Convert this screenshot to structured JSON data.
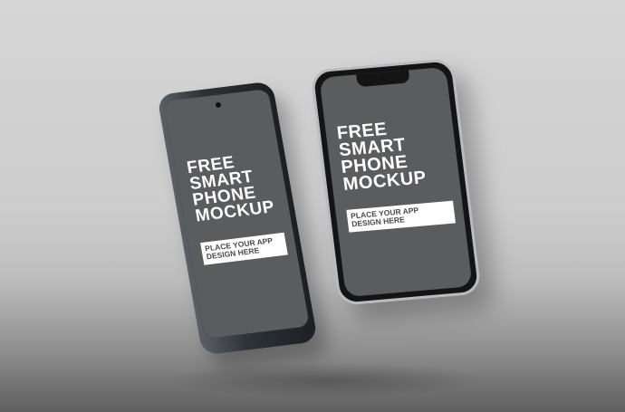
{
  "mockup": {
    "left_phone": {
      "headline": "FREE\nSMART\nPHONE\nMOCKUP",
      "subtext": "PLACE YOUR APP\nDESIGN HERE"
    },
    "right_phone": {
      "headline": "FREE\nSMART\nPHONE\nMOCKUP",
      "subtext": "PLACE YOUR APP\nDESIGN HERE"
    }
  }
}
